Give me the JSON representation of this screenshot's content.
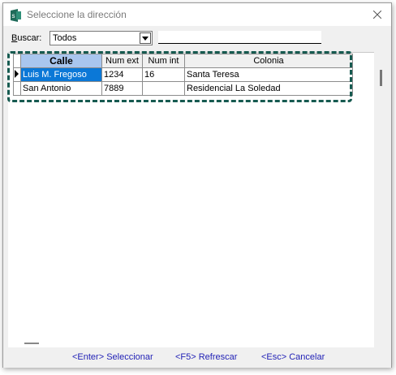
{
  "window": {
    "title": "Seleccione la dirección"
  },
  "toolbar": {
    "search_label_first": "B",
    "search_label_rest": "uscar:",
    "combo_value": "Todos",
    "search_text": ""
  },
  "grid": {
    "columns": [
      "Calle",
      "Num ext",
      "Num int",
      "Colonia"
    ],
    "rows": [
      [
        "Luis M. Fregoso",
        "1234",
        "16",
        "Santa Teresa"
      ],
      [
        "San Antonio",
        "7889",
        "",
        "Residencial La Soledad"
      ]
    ]
  },
  "statusbar": {
    "select_label": "<Enter> Seleccionar",
    "refresh_label": "<F5> Refrescar",
    "cancel_label": "<Esc> Cancelar"
  },
  "colors": {
    "selected_row": "#0b78d7",
    "sorted_header": "#a9c6ee",
    "highlight_border": "#165a50",
    "status_link": "#1f1fb5"
  },
  "icons": [
    "app-icon",
    "close-icon",
    "dropdown-arrow-icon",
    "row-pointer-icon"
  ]
}
